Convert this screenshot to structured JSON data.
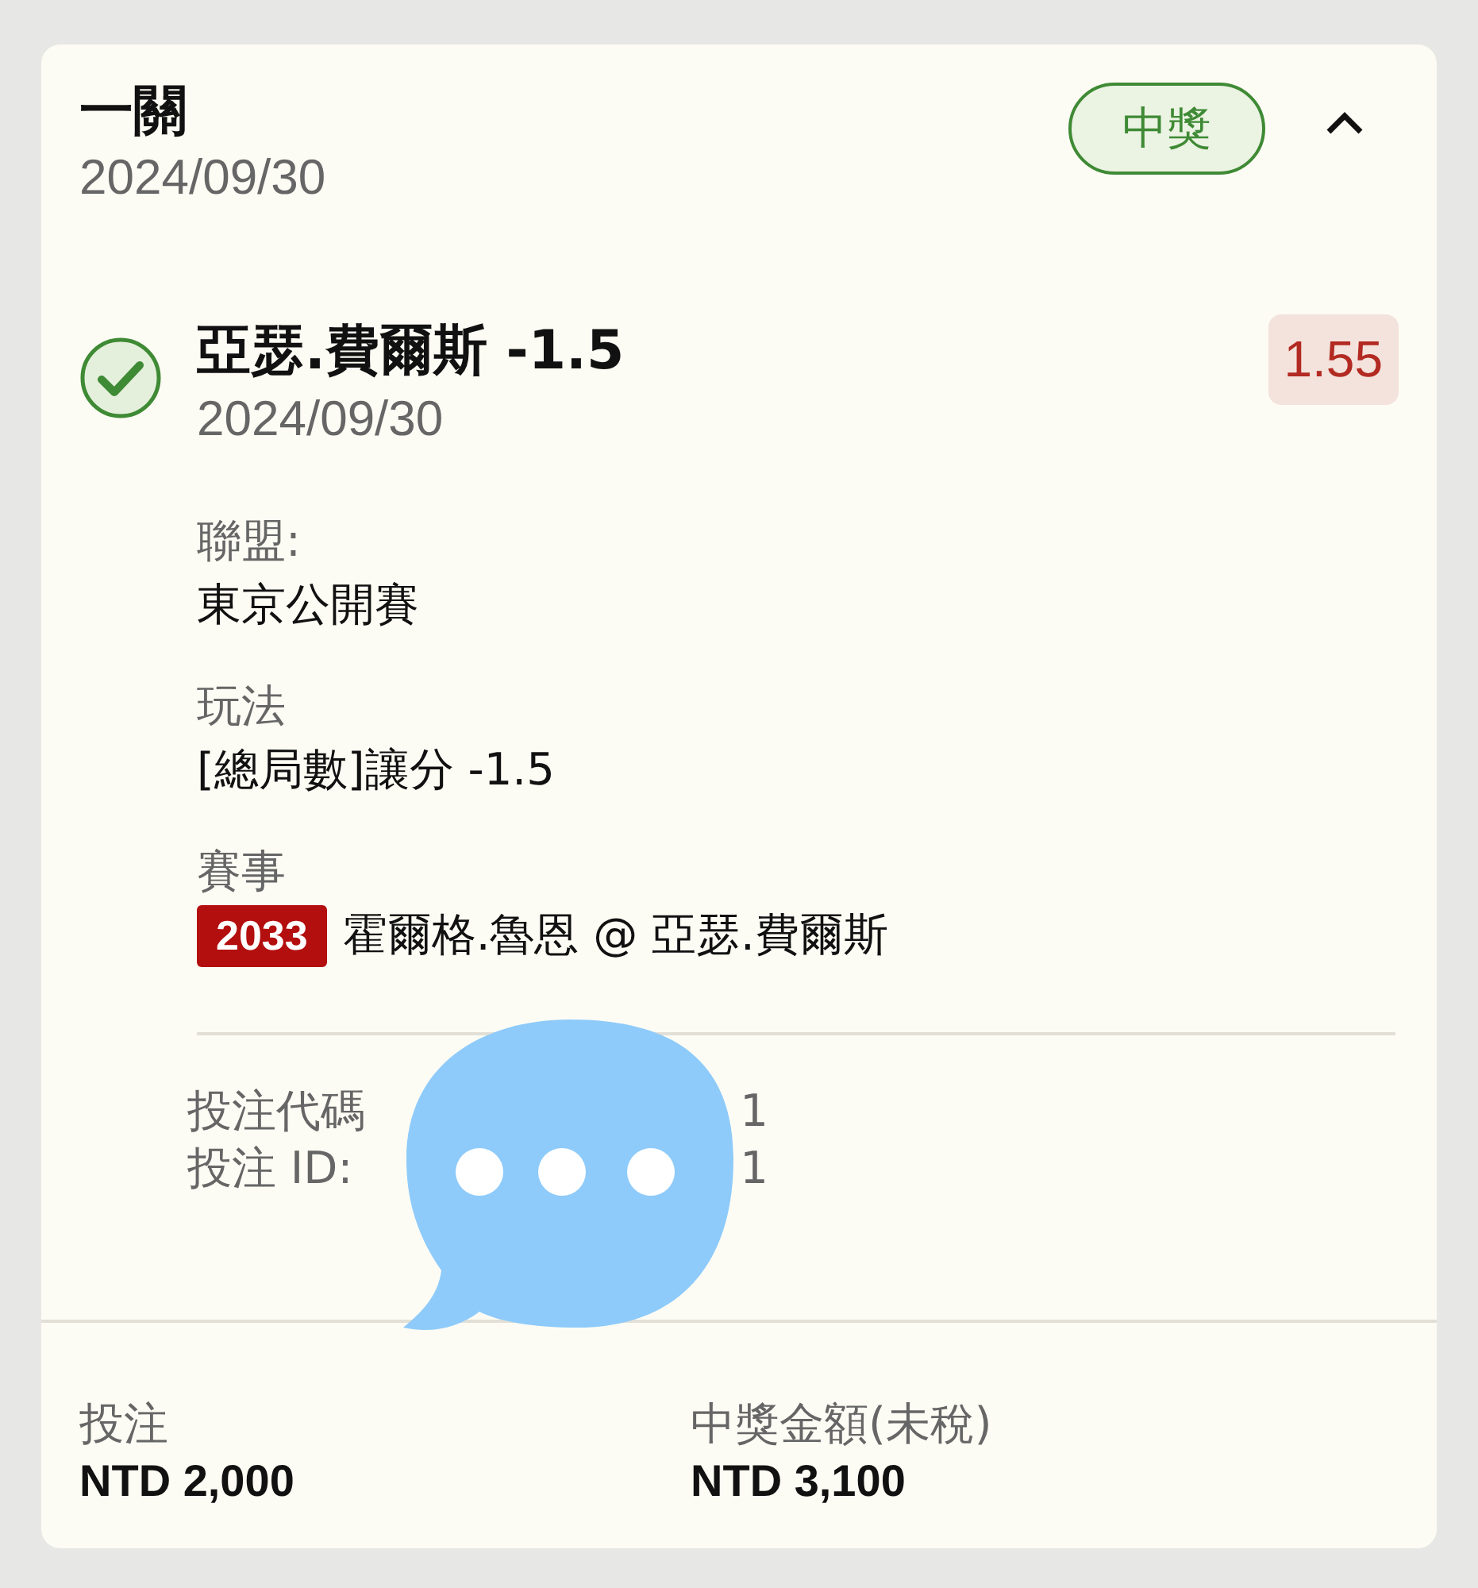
{
  "bet": {
    "title": "一關",
    "date": "2024/09/30",
    "status": {
      "kind": "won",
      "label": "中獎"
    },
    "expanded": true
  },
  "selection": {
    "won": true,
    "name": "亞瑟.費爾斯 -1.5",
    "date": "2024/09/30",
    "odds": "1.55"
  },
  "details": [
    {
      "label": "聯盟:",
      "value": "東京公開賽"
    },
    {
      "label": "玩法",
      "value": "[總局數]讓分 -1.5"
    },
    {
      "label": "賽事",
      "event_code": "2033",
      "value": "霍爾格.魯恩 @ 亞瑟.費爾斯"
    }
  ],
  "codes": [
    {
      "label": "投注代碼",
      "tail": "1"
    },
    {
      "label": "投注 ID:",
      "tail": "1"
    }
  ],
  "footer": [
    {
      "label": "投注",
      "value": "NTD 2,000"
    },
    {
      "label": "中獎金額(未稅)",
      "value": "NTD 3,100"
    }
  ]
}
